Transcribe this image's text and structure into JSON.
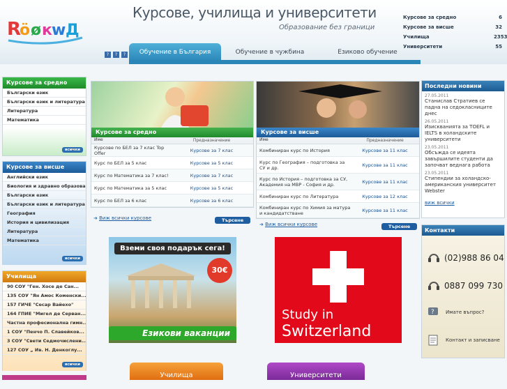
{
  "header": {
    "title": "Курсове, училища и университети",
    "subtitle": "Образование без граници",
    "lang": [
      "?",
      "?",
      "?"
    ],
    "stats": [
      {
        "label": "Курсове за средно",
        "value": "6"
      },
      {
        "label": "Курсове за висше",
        "value": "32"
      },
      {
        "label": "Училища",
        "value": "2353"
      },
      {
        "label": "Университети",
        "value": "55"
      }
    ],
    "tabs": [
      "Обучение в България",
      "Обучение в чужбина",
      "Езиково обучение"
    ]
  },
  "left": {
    "sec1": {
      "title": "Курсове за средно",
      "items": [
        "Български език",
        "Български език и литература",
        "Литература",
        "Математика"
      ],
      "all": "всички"
    },
    "sec2": {
      "title": "Курсове за висше",
      "items": [
        "Английски език",
        "Биология и здравно образование",
        "Български език",
        "Български език и литература",
        "География",
        "История и цивилизация",
        "Литература",
        "Математика"
      ],
      "all": "всички"
    },
    "sec3": {
      "title": "Училища",
      "items": [
        "90 СОУ \"Ген. Хосе де Сан...",
        "135 СОУ \"Ян Амос Коменски...",
        "157 ГИЧЕ \"Сесар Вайехо\"",
        "164 ГПИЕ \"Мигел де Серван...",
        "Частна професионална гимн...",
        "1 СОУ \"Пенчо П. Славейков...",
        "3 СОУ \"Свети Седмочислени...",
        "127 СОУ „ Ив. Н. Денкоглу..."
      ],
      "all": "всички"
    }
  },
  "middle": {
    "col_name": "Име",
    "col_for": "Предназначение",
    "mid": {
      "title": "Курсове за средно",
      "rows": [
        [
          "Курсове по БЕЛ за 7 клас Top Offer",
          "Курсове за 7 клас"
        ],
        [
          "Курс по БЕЛ за 5 клас",
          "Курсове за 5 клас"
        ],
        [
          "Курс по Математика за 7 клас!",
          "Курсове за 7 клас"
        ],
        [
          "Курс по Математика за 5 клас",
          "Курсове за 5 клас"
        ],
        [
          "Курс по БЕЛ за 6 клас",
          "Курсове за 6 клас"
        ]
      ],
      "more": "Виж всички курсове",
      "search": "Търсене"
    },
    "high": {
      "title": "Курсове за висше",
      "rows": [
        [
          "Комбиниран курс по История",
          "Курсове за 11 клас"
        ],
        [
          "Курс по География – подготовка за СУ и др.",
          "Курсове за 11 клас"
        ],
        [
          "Курс по История – подготовка за СУ, Академия на МВР - София и др.",
          "Курсове за 11 клас"
        ],
        [
          "Комбиниран курс по Литература",
          "Курсове за 12 клас"
        ],
        [
          "Комбиниран курс по Химия за матура и кандидатстване",
          "Курсове за 11 клас"
        ]
      ],
      "more": "Виж всички курсове",
      "search": "Търсене"
    },
    "ad1": {
      "top": "Вземи своя подарък сега!",
      "price": "30€",
      "bottom": "Езикови ваканции"
    },
    "ad2": {
      "line1": "Study in",
      "line2": "Switzerland"
    },
    "btn_schools": "Училища",
    "btn_unis": "Университети"
  },
  "right": {
    "news_title": "Последни новини",
    "news": [
      {
        "date": "27.05.2011",
        "text": "Станислав Стратиев се падна на седокласниците днес"
      },
      {
        "date": "26.05.2011",
        "text": "Изискванията за TOEFL и IELTS в холандските университети"
      },
      {
        "date": "23.05.2011",
        "text": "Обсъжда се идеята завършилите студенти да започват веднага работа"
      },
      {
        "date": "23.05.2011",
        "text": "Стипендии за холандско-американския университет Webster"
      }
    ],
    "news_all": "виж всички",
    "contacts_title": "Контакти",
    "phone1": "(02)988 86 04",
    "phone2": "0887 099 730",
    "question": "Имате въпрос?",
    "contact": "Контакт и записване"
  }
}
